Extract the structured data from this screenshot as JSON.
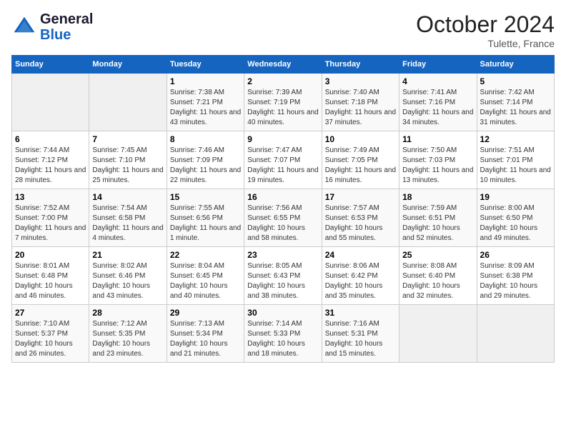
{
  "header": {
    "logo_line1": "General",
    "logo_line2": "Blue",
    "month": "October 2024",
    "location": "Tulette, France"
  },
  "days_of_week": [
    "Sunday",
    "Monday",
    "Tuesday",
    "Wednesday",
    "Thursday",
    "Friday",
    "Saturday"
  ],
  "weeks": [
    [
      {
        "day": "",
        "info": ""
      },
      {
        "day": "",
        "info": ""
      },
      {
        "day": "1",
        "sunrise": "7:38 AM",
        "sunset": "7:21 PM",
        "daylight": "11 hours and 43 minutes."
      },
      {
        "day": "2",
        "sunrise": "7:39 AM",
        "sunset": "7:19 PM",
        "daylight": "11 hours and 40 minutes."
      },
      {
        "day": "3",
        "sunrise": "7:40 AM",
        "sunset": "7:18 PM",
        "daylight": "11 hours and 37 minutes."
      },
      {
        "day": "4",
        "sunrise": "7:41 AM",
        "sunset": "7:16 PM",
        "daylight": "11 hours and 34 minutes."
      },
      {
        "day": "5",
        "sunrise": "7:42 AM",
        "sunset": "7:14 PM",
        "daylight": "11 hours and 31 minutes."
      }
    ],
    [
      {
        "day": "6",
        "sunrise": "7:44 AM",
        "sunset": "7:12 PM",
        "daylight": "11 hours and 28 minutes."
      },
      {
        "day": "7",
        "sunrise": "7:45 AM",
        "sunset": "7:10 PM",
        "daylight": "11 hours and 25 minutes."
      },
      {
        "day": "8",
        "sunrise": "7:46 AM",
        "sunset": "7:09 PM",
        "daylight": "11 hours and 22 minutes."
      },
      {
        "day": "9",
        "sunrise": "7:47 AM",
        "sunset": "7:07 PM",
        "daylight": "11 hours and 19 minutes."
      },
      {
        "day": "10",
        "sunrise": "7:49 AM",
        "sunset": "7:05 PM",
        "daylight": "11 hours and 16 minutes."
      },
      {
        "day": "11",
        "sunrise": "7:50 AM",
        "sunset": "7:03 PM",
        "daylight": "11 hours and 13 minutes."
      },
      {
        "day": "12",
        "sunrise": "7:51 AM",
        "sunset": "7:01 PM",
        "daylight": "11 hours and 10 minutes."
      }
    ],
    [
      {
        "day": "13",
        "sunrise": "7:52 AM",
        "sunset": "7:00 PM",
        "daylight": "11 hours and 7 minutes."
      },
      {
        "day": "14",
        "sunrise": "7:54 AM",
        "sunset": "6:58 PM",
        "daylight": "11 hours and 4 minutes."
      },
      {
        "day": "15",
        "sunrise": "7:55 AM",
        "sunset": "6:56 PM",
        "daylight": "11 hours and 1 minute."
      },
      {
        "day": "16",
        "sunrise": "7:56 AM",
        "sunset": "6:55 PM",
        "daylight": "10 hours and 58 minutes."
      },
      {
        "day": "17",
        "sunrise": "7:57 AM",
        "sunset": "6:53 PM",
        "daylight": "10 hours and 55 minutes."
      },
      {
        "day": "18",
        "sunrise": "7:59 AM",
        "sunset": "6:51 PM",
        "daylight": "10 hours and 52 minutes."
      },
      {
        "day": "19",
        "sunrise": "8:00 AM",
        "sunset": "6:50 PM",
        "daylight": "10 hours and 49 minutes."
      }
    ],
    [
      {
        "day": "20",
        "sunrise": "8:01 AM",
        "sunset": "6:48 PM",
        "daylight": "10 hours and 46 minutes."
      },
      {
        "day": "21",
        "sunrise": "8:02 AM",
        "sunset": "6:46 PM",
        "daylight": "10 hours and 43 minutes."
      },
      {
        "day": "22",
        "sunrise": "8:04 AM",
        "sunset": "6:45 PM",
        "daylight": "10 hours and 40 minutes."
      },
      {
        "day": "23",
        "sunrise": "8:05 AM",
        "sunset": "6:43 PM",
        "daylight": "10 hours and 38 minutes."
      },
      {
        "day": "24",
        "sunrise": "8:06 AM",
        "sunset": "6:42 PM",
        "daylight": "10 hours and 35 minutes."
      },
      {
        "day": "25",
        "sunrise": "8:08 AM",
        "sunset": "6:40 PM",
        "daylight": "10 hours and 32 minutes."
      },
      {
        "day": "26",
        "sunrise": "8:09 AM",
        "sunset": "6:38 PM",
        "daylight": "10 hours and 29 minutes."
      }
    ],
    [
      {
        "day": "27",
        "sunrise": "7:10 AM",
        "sunset": "5:37 PM",
        "daylight": "10 hours and 26 minutes."
      },
      {
        "day": "28",
        "sunrise": "7:12 AM",
        "sunset": "5:35 PM",
        "daylight": "10 hours and 23 minutes."
      },
      {
        "day": "29",
        "sunrise": "7:13 AM",
        "sunset": "5:34 PM",
        "daylight": "10 hours and 21 minutes."
      },
      {
        "day": "30",
        "sunrise": "7:14 AM",
        "sunset": "5:33 PM",
        "daylight": "10 hours and 18 minutes."
      },
      {
        "day": "31",
        "sunrise": "7:16 AM",
        "sunset": "5:31 PM",
        "daylight": "10 hours and 15 minutes."
      },
      {
        "day": "",
        "info": ""
      },
      {
        "day": "",
        "info": ""
      }
    ]
  ]
}
